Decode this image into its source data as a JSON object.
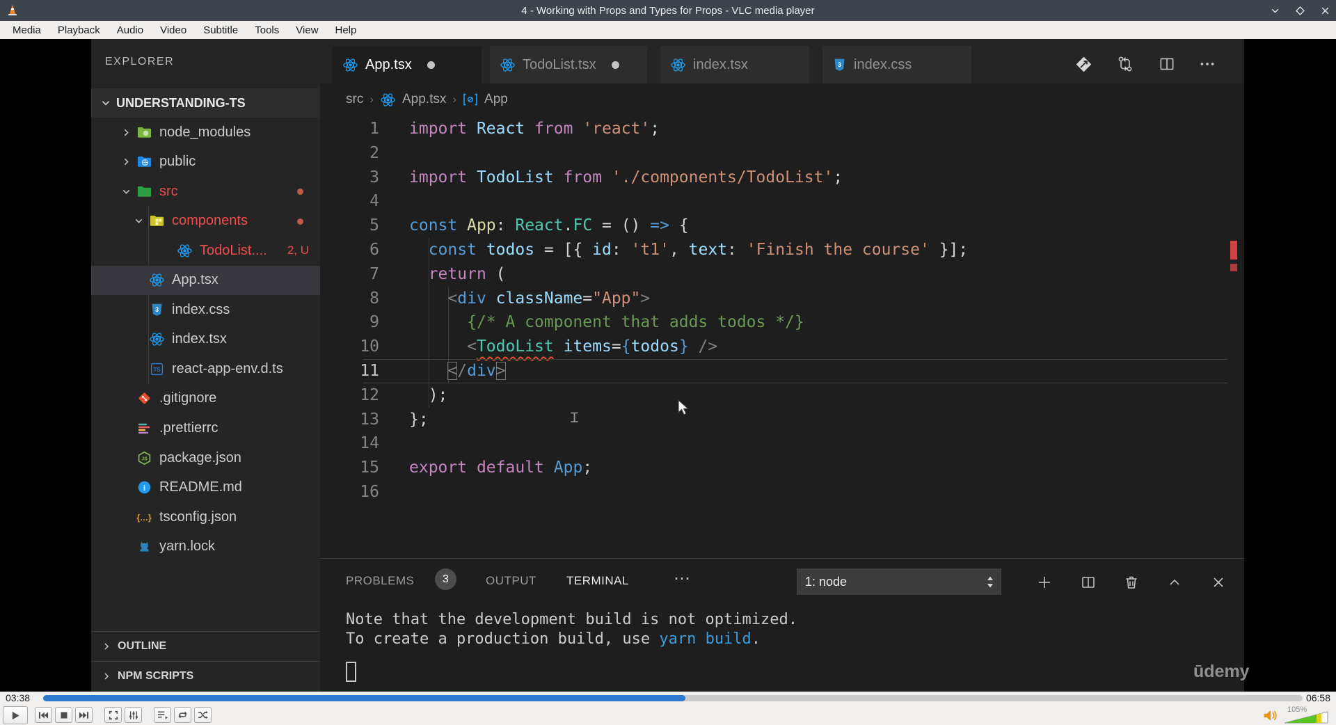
{
  "vlc": {
    "window_title": "4 - Working with Props and Types for Props - VLC media player",
    "menu_items": [
      "Media",
      "Playback",
      "Audio",
      "Video",
      "Subtitle",
      "Tools",
      "View",
      "Help"
    ],
    "elapsed": "03:38",
    "duration": "06:58",
    "progress_percent": 51,
    "volume_percent_label": "105%"
  },
  "colors": {
    "seek_blue": "#2e79d0",
    "error_red": "#f14c4c",
    "keyword_magenta": "#c586c0",
    "keyword_blue": "#569cd6",
    "variable_blue": "#9cdcfe",
    "string_orange": "#ce9178",
    "type_teal": "#4ec9b0",
    "comment_green": "#6a9955",
    "terminal_link_blue": "#3b9ddd",
    "volume_icon_orange": "#e79512"
  },
  "vscode": {
    "explorer_title": "EXPLORER",
    "root_folder": "UNDERSTANDING-TS",
    "tree": [
      {
        "label": "node_modules",
        "icon": "folder-node-modules",
        "depth": 1,
        "chevron": "collapsed"
      },
      {
        "label": "public",
        "icon": "folder-public",
        "depth": 1,
        "chevron": "collapsed"
      },
      {
        "label": "src",
        "icon": "folder-src",
        "depth": 1,
        "chevron": "expanded",
        "error": true,
        "dot": true
      },
      {
        "label": "components",
        "icon": "folder-components",
        "depth": 2,
        "chevron": "expanded",
        "error": true,
        "dot": true
      },
      {
        "label": "TodoList....",
        "icon": "react",
        "depth": 3,
        "error": true,
        "badge": "2, U"
      },
      {
        "label": "App.tsx",
        "icon": "react",
        "depth": 2,
        "selected": true
      },
      {
        "label": "index.css",
        "icon": "css",
        "depth": 2
      },
      {
        "label": "index.tsx",
        "icon": "react",
        "depth": 2
      },
      {
        "label": "react-app-env.d.ts",
        "icon": "ts",
        "depth": 2
      },
      {
        "label": ".gitignore",
        "icon": "git",
        "depth": 1
      },
      {
        "label": ".prettierrc",
        "icon": "prettier",
        "depth": 1
      },
      {
        "label": "package.json",
        "icon": "npm",
        "depth": 1
      },
      {
        "label": "README.md",
        "icon": "info",
        "depth": 1
      },
      {
        "label": "tsconfig.json",
        "icon": "braces",
        "depth": 1
      },
      {
        "label": "yarn.lock",
        "icon": "yarn",
        "depth": 1
      }
    ],
    "bottom_sections": [
      "OUTLINE",
      "NPM SCRIPTS"
    ],
    "tabs": [
      {
        "label": "App.tsx",
        "icon": "react",
        "active": true,
        "modified": true
      },
      {
        "label": "TodoList.tsx",
        "icon": "react",
        "modified": true
      },
      {
        "label": "index.tsx",
        "icon": "react"
      },
      {
        "label": "index.css",
        "icon": "css"
      }
    ],
    "breadcrumb": {
      "segments": [
        "src",
        "App.tsx",
        "App"
      ]
    },
    "editor": {
      "current_line": 11,
      "code_lines": [
        [
          [
            "k",
            "import"
          ],
          [
            "p",
            " "
          ],
          [
            "v",
            "React"
          ],
          [
            "p",
            " "
          ],
          [
            "k",
            "from"
          ],
          [
            "p",
            " "
          ],
          [
            "s",
            "'react'"
          ],
          [
            "p",
            ";"
          ]
        ],
        [],
        [
          [
            "k",
            "import"
          ],
          [
            "p",
            " "
          ],
          [
            "v",
            "TodoList"
          ],
          [
            "p",
            " "
          ],
          [
            "k",
            "from"
          ],
          [
            "p",
            " "
          ],
          [
            "s",
            "'./components/TodoList'"
          ],
          [
            "p",
            ";"
          ]
        ],
        [],
        [
          [
            "kb",
            "const"
          ],
          [
            "p",
            " "
          ],
          [
            "fn",
            "App"
          ],
          [
            "p",
            ": "
          ],
          [
            "ty",
            "React"
          ],
          [
            "p",
            "."
          ],
          [
            "ty",
            "FC"
          ],
          [
            "p",
            " = () "
          ],
          [
            "kb",
            "=>"
          ],
          [
            "p",
            " {"
          ]
        ],
        [
          [
            "p",
            "  "
          ],
          [
            "kb",
            "const"
          ],
          [
            "p",
            " "
          ],
          [
            "v",
            "todos"
          ],
          [
            "p",
            " = [{ "
          ],
          [
            "v",
            "id"
          ],
          [
            "p",
            ": "
          ],
          [
            "s",
            "'t1'"
          ],
          [
            "p",
            ", "
          ],
          [
            "v",
            "text"
          ],
          [
            "p",
            ": "
          ],
          [
            "s",
            "'Finish the course'"
          ],
          [
            "p",
            " }];"
          ]
        ],
        [
          [
            "p",
            "  "
          ],
          [
            "k",
            "return"
          ],
          [
            "p",
            " ("
          ]
        ],
        [
          [
            "p",
            "    "
          ],
          [
            "ag",
            "<"
          ],
          [
            "kb",
            "div"
          ],
          [
            "p",
            " "
          ],
          [
            "v",
            "className"
          ],
          [
            "p",
            "="
          ],
          [
            "s",
            "\"App\""
          ],
          [
            "ag",
            ">"
          ]
        ],
        [
          [
            "p",
            "      "
          ],
          [
            "cm",
            "{/* A component that adds todos */}"
          ]
        ],
        [
          [
            "p",
            "      "
          ],
          [
            "ag",
            "<"
          ],
          [
            "tyerr",
            "TodoList"
          ],
          [
            "p",
            " "
          ],
          [
            "v",
            "items"
          ],
          [
            "p",
            "="
          ],
          [
            "bb",
            "{"
          ],
          [
            "v",
            "todos"
          ],
          [
            "bb",
            "}"
          ],
          [
            "p",
            " "
          ],
          [
            "ag",
            "/>"
          ]
        ],
        [
          [
            "p",
            "    "
          ],
          [
            "agm",
            "<"
          ],
          [
            "ag",
            "/"
          ],
          [
            "kb",
            "div"
          ],
          [
            "agm",
            ">"
          ]
        ],
        [
          [
            "p",
            "  );"
          ]
        ],
        [
          [
            "p",
            "};"
          ]
        ],
        [],
        [
          [
            "k",
            "export"
          ],
          [
            "p",
            " "
          ],
          [
            "k",
            "default"
          ],
          [
            "p",
            " "
          ],
          [
            "kb",
            "App"
          ],
          [
            "p",
            ";"
          ]
        ],
        []
      ]
    },
    "panel": {
      "tabs": [
        {
          "label": "PROBLEMS",
          "badge": "3"
        },
        {
          "label": "OUTPUT"
        },
        {
          "label": "TERMINAL",
          "active": true
        }
      ],
      "terminal_select": "1: node",
      "terminal_lines": [
        [
          [
            "t",
            "Note that the development build is not optimized."
          ]
        ],
        [
          [
            "t",
            "To create a production build, use "
          ],
          [
            "cmd",
            "yarn build"
          ],
          [
            "t",
            "."
          ]
        ]
      ],
      "watermark": "ūdemy"
    }
  }
}
